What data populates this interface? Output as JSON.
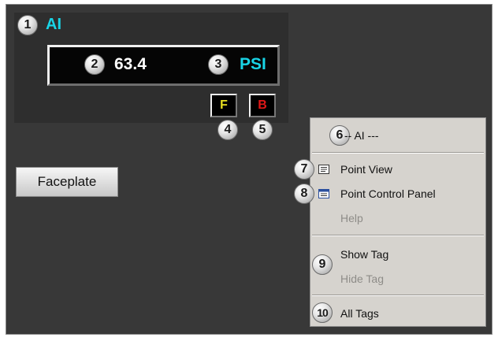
{
  "faceplate_panel": {
    "tag_type": "AI",
    "process_value": "63.4",
    "units": "PSI",
    "f_button_label": "F",
    "b_button_label": "B",
    "faceplate_button_label": "Faceplate"
  },
  "context_menu": {
    "header": "-- AI ---",
    "point_view": "Point View",
    "point_control_panel": "Point Control Panel",
    "help": "Help",
    "show_tag": "Show Tag",
    "hide_tag": "Hide Tag",
    "all_tags": "All Tags"
  },
  "callouts": [
    "1",
    "2",
    "3",
    "4",
    "5",
    "6",
    "7",
    "8",
    "9",
    "10"
  ],
  "colors": {
    "background": "#383838",
    "accent_cyan": "#19d4e6",
    "f_yellow": "#e8e021",
    "b_red": "#e01818",
    "menu_bg": "#d6d3ce"
  },
  "icons": {
    "point_view": "point-view-icon",
    "point_control_panel": "point-control-panel-icon"
  }
}
